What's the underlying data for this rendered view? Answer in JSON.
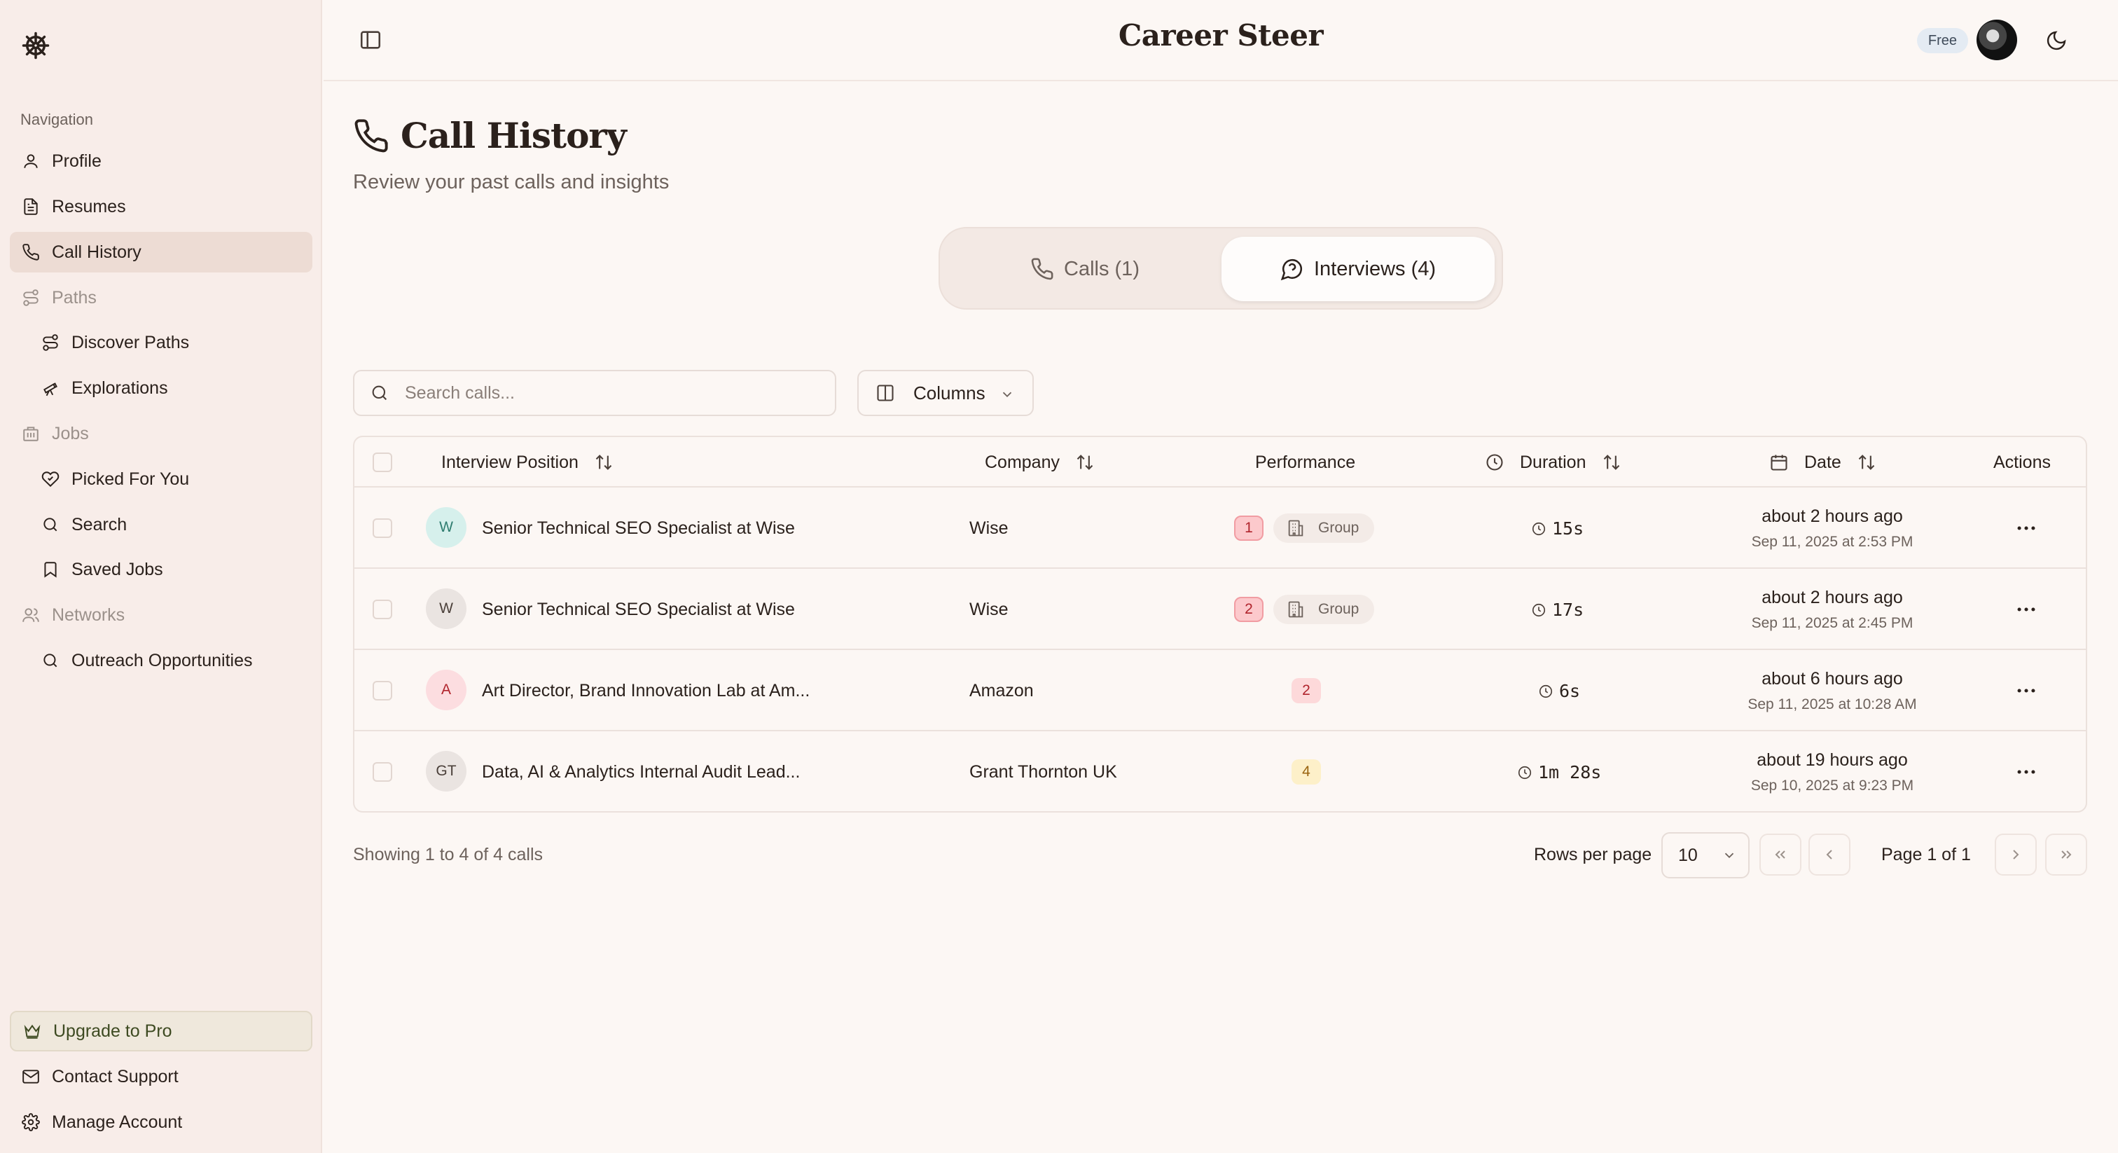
{
  "app": {
    "brand": "Career Steer",
    "plan_badge": "Free"
  },
  "sidebar": {
    "heading": "Navigation",
    "items": [
      {
        "label": "Profile",
        "icon": "user-icon"
      },
      {
        "label": "Resumes",
        "icon": "file-text-icon"
      },
      {
        "label": "Call History",
        "icon": "phone-icon",
        "active": true
      },
      {
        "label": "Paths",
        "icon": "route-icon",
        "section": true
      },
      {
        "label": "Discover Paths",
        "icon": "route-icon"
      },
      {
        "label": "Explorations",
        "icon": "telescope-icon"
      },
      {
        "label": "Jobs",
        "icon": "building-icon",
        "section": true
      },
      {
        "label": "Picked For You",
        "icon": "heart-icon"
      },
      {
        "label": "Search",
        "icon": "search-icon"
      },
      {
        "label": "Saved Jobs",
        "icon": "bookmark-icon"
      },
      {
        "label": "Networks",
        "icon": "users-icon",
        "section": true
      },
      {
        "label": "Outreach Opportunities",
        "icon": "search-icon"
      }
    ],
    "bottom": [
      {
        "label": "Upgrade to Pro",
        "icon": "crown-icon"
      },
      {
        "label": "Contact Support",
        "icon": "mail-icon"
      },
      {
        "label": "Manage Account",
        "icon": "gear-icon"
      }
    ]
  },
  "page": {
    "title": "Call History",
    "subtitle": "Review your past calls and insights"
  },
  "tabs": [
    {
      "label": "Calls (1)",
      "active": false
    },
    {
      "label": "Interviews (4)",
      "active": true
    }
  ],
  "search": {
    "placeholder": "Search calls..."
  },
  "columns_button": {
    "label": "Columns"
  },
  "table": {
    "headers": {
      "position": "Interview Position",
      "company": "Company",
      "performance": "Performance",
      "duration": "Duration",
      "date": "Date",
      "actions": "Actions"
    },
    "rows": [
      {
        "initials": "W",
        "avatar_bg": "#d6f0ec",
        "avatar_fg": "#2f7d70",
        "position": "Senior Technical SEO Specialist at Wise",
        "company": "Wise",
        "score": "1",
        "score_style": "red",
        "tag": "Group",
        "duration": "15s",
        "date_relative": "about 2 hours ago",
        "date_absolute": "Sep 11, 2025 at 2:53 PM"
      },
      {
        "initials": "W",
        "avatar_bg": "#eae4e1",
        "avatar_fg": "#4a3f39",
        "position": "Senior Technical SEO Specialist at Wise",
        "company": "Wise",
        "score": "2",
        "score_style": "red",
        "tag": "Group",
        "duration": "17s",
        "date_relative": "about 2 hours ago",
        "date_absolute": "Sep 11, 2025 at 2:45 PM"
      },
      {
        "initials": "A",
        "avatar_bg": "#fcdde0",
        "avatar_fg": "#b0242c",
        "position": "Art Director, Brand Innovation Lab at Am...",
        "company": "Amazon",
        "score": "2",
        "score_style": "redsoft",
        "tag": "",
        "duration": "6s",
        "date_relative": "about 6 hours ago",
        "date_absolute": "Sep 11, 2025 at 10:28 AM"
      },
      {
        "initials": "GT",
        "avatar_bg": "#eae4e1",
        "avatar_fg": "#4a3f39",
        "position": "Data, AI & Analytics Internal Audit Lead...",
        "company": "Grant Thornton UK",
        "score": "4",
        "score_style": "amber",
        "tag": "",
        "duration": "1m 28s",
        "date_relative": "about 19 hours ago",
        "date_absolute": "Sep 10, 2025 at 9:23 PM"
      }
    ]
  },
  "footer": {
    "showing": "Showing 1 to 4 of 4 calls",
    "rows_per_page_label": "Rows per page",
    "rows_per_page_value": "10",
    "page_of": "Page 1 of 1"
  }
}
